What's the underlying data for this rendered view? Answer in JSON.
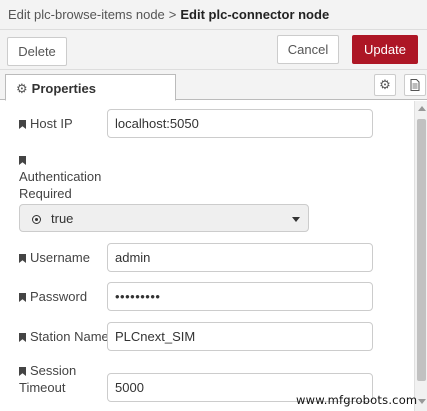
{
  "breadcrumb": {
    "parent": "Edit plc-browse-items node",
    "separator": ">",
    "current": "Edit plc-connector node"
  },
  "toolbar": {
    "delete_label": "Delete",
    "cancel_label": "Cancel",
    "update_label": "Update",
    "accent_color": "#ad1625"
  },
  "tabs": {
    "properties_label": "Properties",
    "settings_icon": "gear-icon",
    "description_icon": "document-icon"
  },
  "form": {
    "host_ip": {
      "label": "Host IP",
      "value": "localhost:5050"
    },
    "authentication": {
      "label_line1": "Authentication",
      "label_line2": "Required",
      "value": "true"
    },
    "username": {
      "label": "Username",
      "value": "admin"
    },
    "password": {
      "label": "Password",
      "value": "•••••••••"
    },
    "station_name": {
      "label": "Station Name",
      "value": "PLCnext_SIM"
    },
    "session_timeout": {
      "label_line1": "Session",
      "label_line2": "Timeout",
      "value": "5000"
    }
  },
  "watermark": "www.mfgrobots.com"
}
